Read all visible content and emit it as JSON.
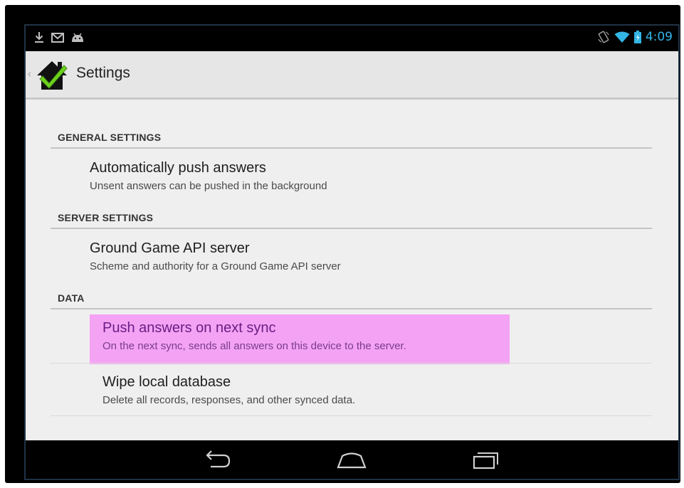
{
  "status_bar": {
    "left_icons": [
      "download-icon",
      "gmail-icon",
      "android-debug-icon"
    ],
    "right_icons": [
      "rotation-lock-icon",
      "wifi-icon",
      "battery-icon"
    ],
    "time": "4:09"
  },
  "action_bar": {
    "title": "Settings",
    "logo_icon": "house-checkmark-logo-icon"
  },
  "sections": {
    "general": {
      "header": "GENERAL SETTINGS",
      "items": [
        {
          "title": "Automatically push answers",
          "summary": "Unsent answers can be pushed in the background"
        }
      ]
    },
    "server": {
      "header": "SERVER SETTINGS",
      "items": [
        {
          "title": "Ground Game API server",
          "summary": "Scheme and authority for a Ground Game API server"
        }
      ]
    },
    "data": {
      "header": "DATA",
      "items": [
        {
          "title": "Push answers on next sync",
          "summary": "On the next sync, sends all answers on this device to the server.",
          "highlighted": true
        },
        {
          "title": "Wipe local database",
          "summary": "Delete all records, responses, and other synced data."
        }
      ]
    }
  },
  "colors": {
    "highlight": "#f4a3f4",
    "time_accent": "#33b5e5",
    "logo_green": "#6fd21e"
  },
  "nav_bar": {
    "buttons": [
      "back-icon",
      "home-icon",
      "recent-apps-icon"
    ]
  }
}
